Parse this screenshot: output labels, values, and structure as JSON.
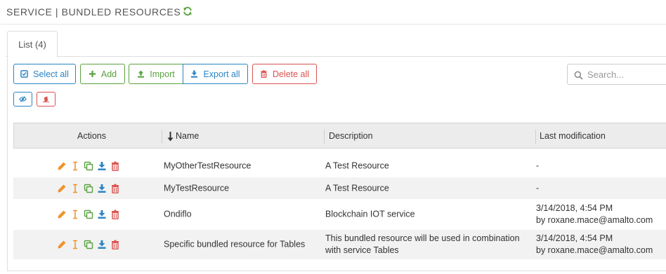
{
  "header": {
    "title": "SERVICE | BUNDLED RESOURCES",
    "refresh_icon": "refresh-icon"
  },
  "tabs": [
    {
      "label": "List (4)",
      "active": true
    }
  ],
  "toolbar": {
    "select_all": "Select all",
    "add": "Add",
    "import": "Import",
    "export_all": "Export all",
    "delete_all": "Delete all",
    "search_placeholder": "Search...",
    "toggle_visibility_icon": "eye-slash-icon",
    "clear_icon": "eraser-icon"
  },
  "table": {
    "columns": {
      "actions": "Actions",
      "name": "Name",
      "description": "Description",
      "last_modification": "Last modification"
    },
    "sort_column": "name",
    "rows": [
      {
        "name": "MyOtherTestResource",
        "description_lines": [
          "A Test Resource",
          ""
        ],
        "modified_lines": [
          "-",
          ""
        ]
      },
      {
        "name": "MyTestResource",
        "description_lines": [
          "A Test Resource",
          ""
        ],
        "modified_lines": [
          "-",
          ""
        ]
      },
      {
        "name": "Ondiflo",
        "description_lines": [
          "Blockchain IOT service",
          ""
        ],
        "modified_lines": [
          "3/14/2018, 4:54 PM",
          "by roxane.mace@amalto.com"
        ]
      },
      {
        "name": "Specific bundled resource for Tables",
        "description_lines": [
          "This bundled resource will be used in combination",
          "with service Tables"
        ],
        "modified_lines": [
          "3/14/2018, 4:54 PM",
          "by roxane.mace@amalto.com"
        ]
      }
    ]
  },
  "colors": {
    "blue": "#2b85c4",
    "green": "#59a23e",
    "red": "#d9534f",
    "orange": "#f0932b",
    "row_stripe": "#f2f2f2"
  }
}
